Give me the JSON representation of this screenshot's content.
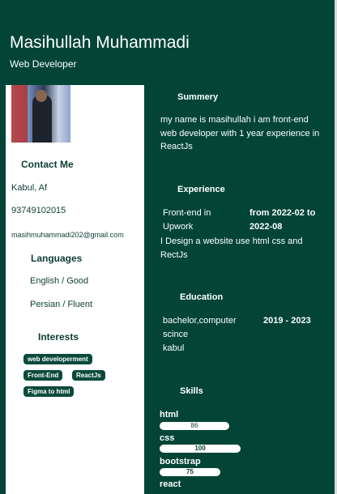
{
  "header": {
    "name": "Masihullah Muhammadi",
    "role": "Web Developer"
  },
  "sidebar": {
    "contact": {
      "heading": "Contact Me",
      "location": "Kabul, Af",
      "phone": "93749102015",
      "email": "masihmuhammadi202@gmail.com"
    },
    "languages": {
      "heading": "Languages",
      "items": [
        "English / Good",
        "Persian / Fluent"
      ]
    },
    "interests": {
      "heading": "Interests",
      "items": [
        "web developerment",
        "Front-End",
        "ReactJs",
        "Figma to html"
      ]
    }
  },
  "main": {
    "summary": {
      "heading": "Summery",
      "text": "my name is masihullah i am front-end web developer with 1 year experience in ReactJs"
    },
    "experience": {
      "heading": "Experience",
      "role_line1": "Front-end in",
      "role_line2": "Upwork",
      "period_line1": "from 2022-02 to",
      "period_line2": "2022-08",
      "description": "I Design a website use html css and RectJs"
    },
    "education": {
      "heading": "Education",
      "degree_line1": "bachelor,computer",
      "degree_line2": "scince",
      "degree_line3": "kabul",
      "period": "2019 - 2023"
    },
    "skills": {
      "heading": "Skills",
      "items": [
        {
          "name": "html",
          "level": "86",
          "value": 86
        },
        {
          "name": "css",
          "level": "100",
          "value": 100
        },
        {
          "name": "bootstrap",
          "level": "75",
          "value": 75
        },
        {
          "name": "react"
        }
      ]
    }
  },
  "colors": {
    "background": "#024536",
    "sidebar": "#ffffff",
    "chip": "#0a4a3b"
  }
}
